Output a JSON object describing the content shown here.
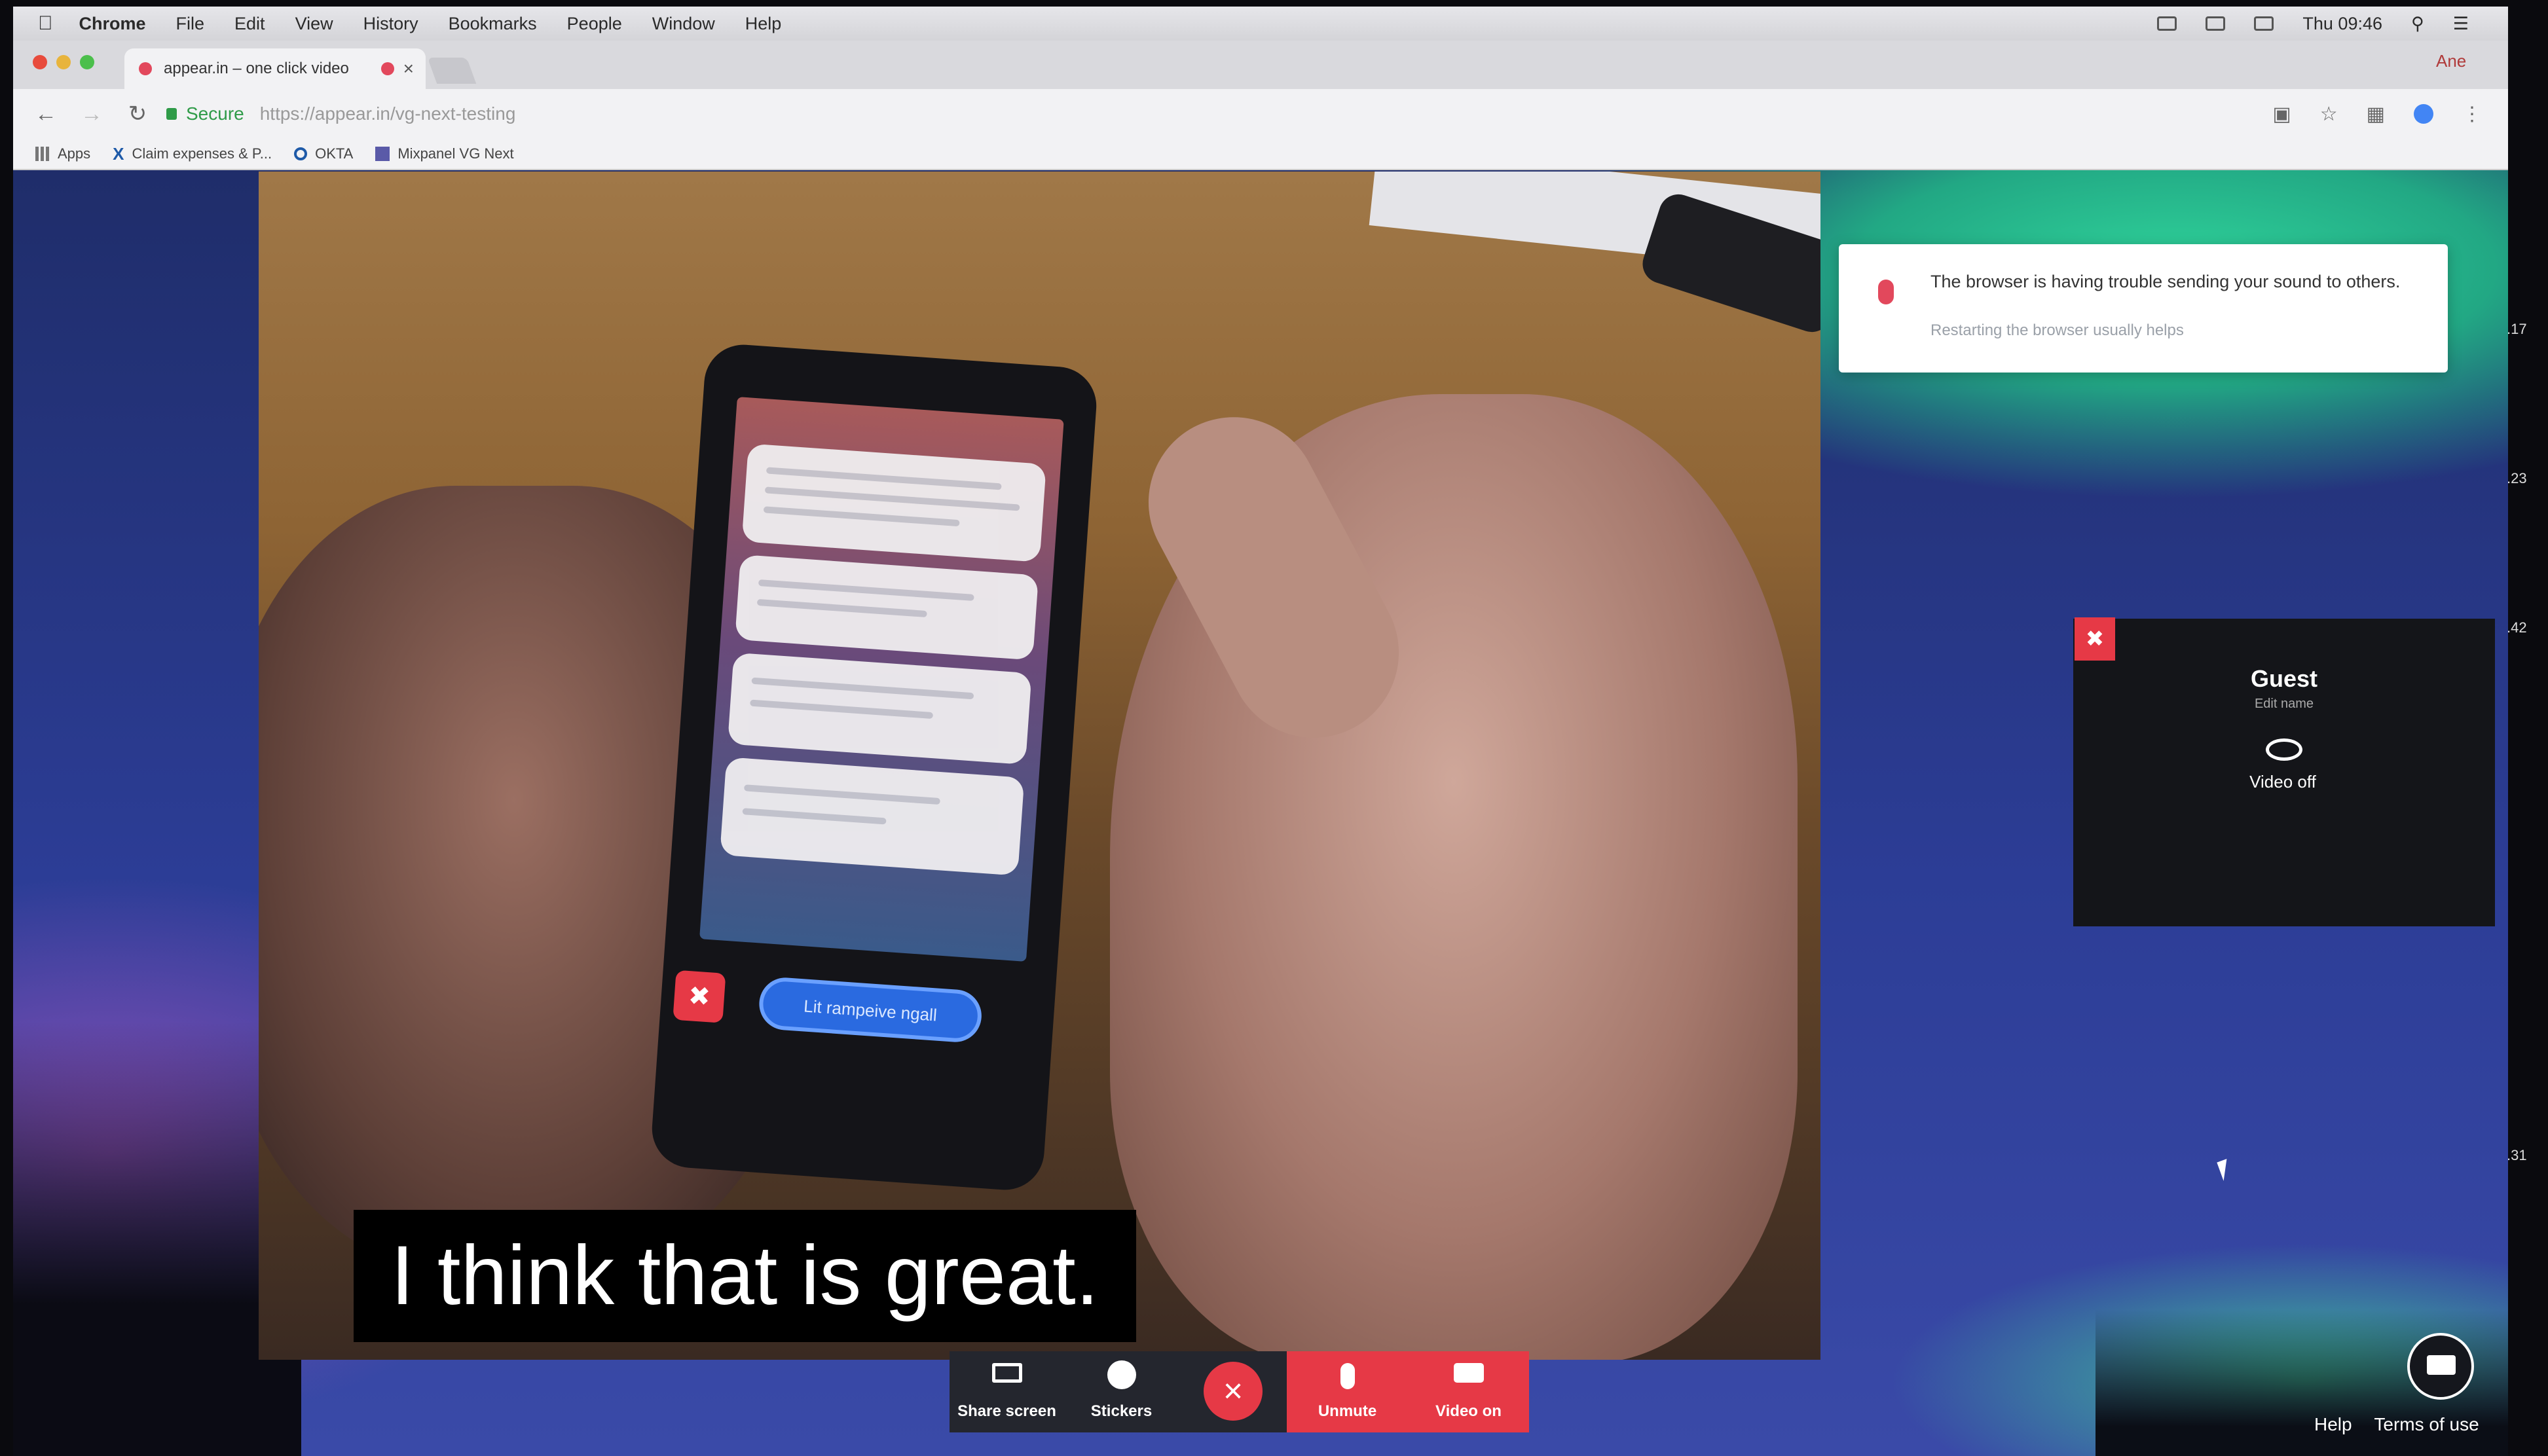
{
  "menubar": {
    "apple": "",
    "app": "Chrome",
    "items": [
      "File",
      "Edit",
      "View",
      "History",
      "Bookmarks",
      "People",
      "Window",
      "Help"
    ],
    "clock": "Thu 09:46"
  },
  "tab": {
    "title": "appear.in – one click video",
    "close": "×",
    "profile": "Ane"
  },
  "address": {
    "secure_label": "Secure",
    "url": "https://appear.in/vg-next-testing"
  },
  "bookmarks": [
    "Apps",
    "Claim expenses & P...",
    "OKTA",
    "Mixpanel VG Next"
  ],
  "phone": {
    "pill_text": "Lit rampeive ngall"
  },
  "subtitle": "I think that is great.",
  "toast": {
    "message": "The browser is having trouble sending your sound to others.",
    "hint": "Restarting the browser usually helps"
  },
  "self_view": {
    "name": "Guest",
    "edit": "Edit name",
    "video_status": "Video off"
  },
  "controls": {
    "share": "Share screen",
    "stickers": "Stickers",
    "leave": "×",
    "unmute": "Unmute",
    "video_on": "Video on"
  },
  "footer": {
    "help": "Help",
    "terms": "Terms of use"
  },
  "edge_numbers": [
    ".17",
    ".23",
    ".42",
    ".31"
  ],
  "colors": {
    "accent_red": "#e63946",
    "secure_green": "#2f9b48"
  }
}
